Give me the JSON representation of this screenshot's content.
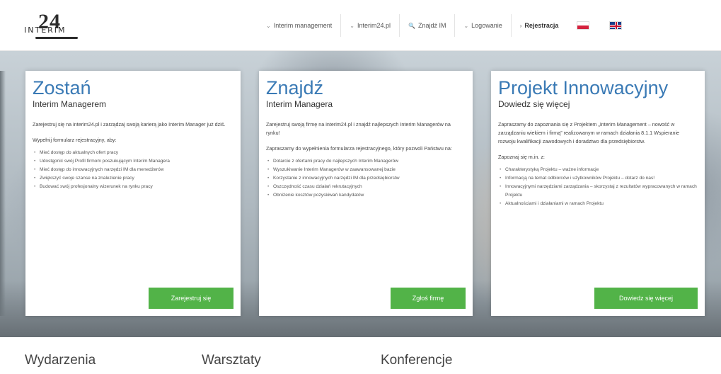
{
  "logo": {
    "digits": "24",
    "word": "INTERIM"
  },
  "nav": {
    "items": [
      {
        "label": "Interim management",
        "arrow": "⌄"
      },
      {
        "label": "Interim24.pl",
        "arrow": "⌄"
      },
      {
        "label": "Znajdź IM",
        "arrow": "🔍"
      },
      {
        "label": "Logowanie",
        "arrow": "⌄"
      },
      {
        "label": "Rejestracja",
        "arrow": "›"
      }
    ],
    "flags": [
      "pl-flag",
      "uk-flag"
    ]
  },
  "panels": [
    {
      "title": "Zostań",
      "subtitle": "Interim Managerem",
      "intro": "Zarejestruj się na interim24.pl i zarządzaj swoją karierą jako Interim Manager już dziś.",
      "lead": "Wypełnij formularz rejestracyjny, aby:",
      "items": [
        "Mieć dostęp do aktualnych ofert pracy",
        "Udostępnić swój Profil firmom poszukującym Interim Managera",
        "Mieć dostęp do innowacyjnych narzędzi IM dla menedżerów",
        "Zwiększyć swoje szanse na znalezienie pracy",
        "Budować swój profesjonalny wizerunek na rynku pracy"
      ],
      "button": "Zarejestruj się"
    },
    {
      "title": "Znajdź",
      "subtitle": "Interim Managera",
      "intro": "Zarejestruj swoją firmę na interim24.pl i znajdź najlepszych Interim Managerów na rynku!",
      "lead": "Zapraszamy do wypełnienia formularza rejestracyjnego, który pozwoli Państwu na:",
      "items": [
        "Dotarcie z ofertami pracy do najlepszych Interim Managerów",
        "Wyszukiwanie Interim Managerów w zaawansowanej bazie",
        "Korzystanie z innowacyjnych narzędzi IM dla przedsiębiorstw",
        "Oszczędność czasu działań rekrutacyjnych",
        "Obniżenie kosztów pozyskiwań kandydatów"
      ],
      "button": "Zgłoś firmę"
    },
    {
      "title": "Projekt Innowacyjny",
      "subtitle": "Dowiedz się więcej",
      "intro": "Zapraszamy do zapoznania się z Projektem „Interim Management – nowość w zarządzaniu wiekiem i firmą” realizowanym w ramach działania 8.1.1 Wspieranie rozwoju kwalifikacji zawodowych i doradztwo dla przedsiębiorstw.",
      "lead": "Zapoznaj się m.in. z:",
      "items": [
        "Charakterystyką Projektu – ważne informacje",
        "Informacją na temat odbiorców i użytkowników Projektu – dotarz do nas!",
        "Innowacyjnymi narzędziami zarządzania – skorzystaj z rezultatów wypracowanych w ramach Projektu",
        "Aktualnościami i działaniami w ramach Projektu"
      ],
      "button": "Dowiedz się więcej"
    }
  ],
  "sections": [
    "Wydarzenia",
    "Warsztaty",
    "Konferencje"
  ]
}
